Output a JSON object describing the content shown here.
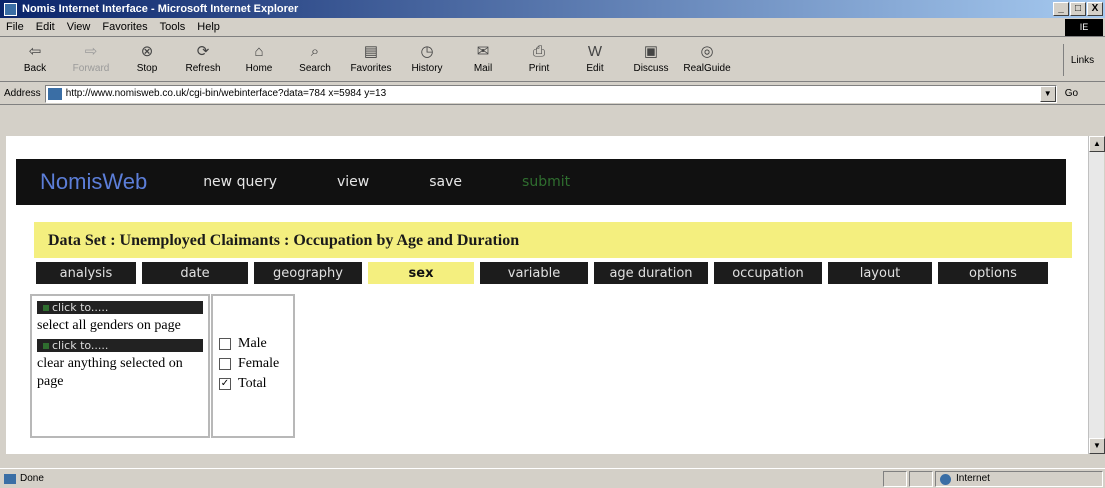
{
  "window": {
    "title": "Nomis Internet Interface - Microsoft Internet Explorer",
    "minimize": "_",
    "maximize": "□",
    "close": "X"
  },
  "menu": {
    "items": [
      "File",
      "Edit",
      "View",
      "Favorites",
      "Tools",
      "Help"
    ]
  },
  "toolbar": {
    "buttons": [
      {
        "label": "Back",
        "icon": "back-arrow-icon",
        "glyph": "⇦"
      },
      {
        "label": "Forward",
        "icon": "forward-arrow-icon",
        "glyph": "⇨"
      },
      {
        "label": "Stop",
        "icon": "stop-icon",
        "glyph": "⊗"
      },
      {
        "label": "Refresh",
        "icon": "refresh-icon",
        "glyph": "⟳"
      },
      {
        "label": "Home",
        "icon": "home-icon",
        "glyph": "⌂"
      },
      {
        "label": "Search",
        "icon": "search-icon",
        "glyph": "⌕"
      },
      {
        "label": "Favorites",
        "icon": "favorites-icon",
        "glyph": "▤"
      },
      {
        "label": "History",
        "icon": "history-icon",
        "glyph": "◷"
      },
      {
        "label": "Mail",
        "icon": "mail-icon",
        "glyph": "✉"
      },
      {
        "label": "Print",
        "icon": "print-icon",
        "glyph": "⎙"
      },
      {
        "label": "Edit",
        "icon": "edit-icon",
        "glyph": "W"
      },
      {
        "label": "Discuss",
        "icon": "discuss-icon",
        "glyph": "▣"
      },
      {
        "label": "RealGuide",
        "icon": "realguide-icon",
        "glyph": "◎"
      }
    ],
    "links": "Links"
  },
  "address": {
    "label": "Address",
    "url": "http://www.nomisweb.co.uk/cgi-bin/webinterface?data=784 x=5984 y=13",
    "go": "Go"
  },
  "nomis": {
    "logo": "NomisWeb",
    "nav": [
      "new query",
      "view",
      "save",
      "submit"
    ],
    "dataset_title": "Data Set : Unemployed Claimants : Occupation by Age and Duration",
    "tabs": [
      "analysis",
      "date",
      "geography",
      "sex",
      "variable",
      "age duration",
      "occupation",
      "layout",
      "options"
    ],
    "active_tab": "sex"
  },
  "left_panel": {
    "click1": "click to.....",
    "text1": "select all genders on page",
    "click2": "click to.....",
    "text2": "clear anything selected on page"
  },
  "genders": [
    {
      "label": "Male",
      "checked": false
    },
    {
      "label": "Female",
      "checked": false
    },
    {
      "label": "Total",
      "checked": true
    }
  ],
  "status": {
    "text": "Done",
    "zone": "Internet"
  }
}
